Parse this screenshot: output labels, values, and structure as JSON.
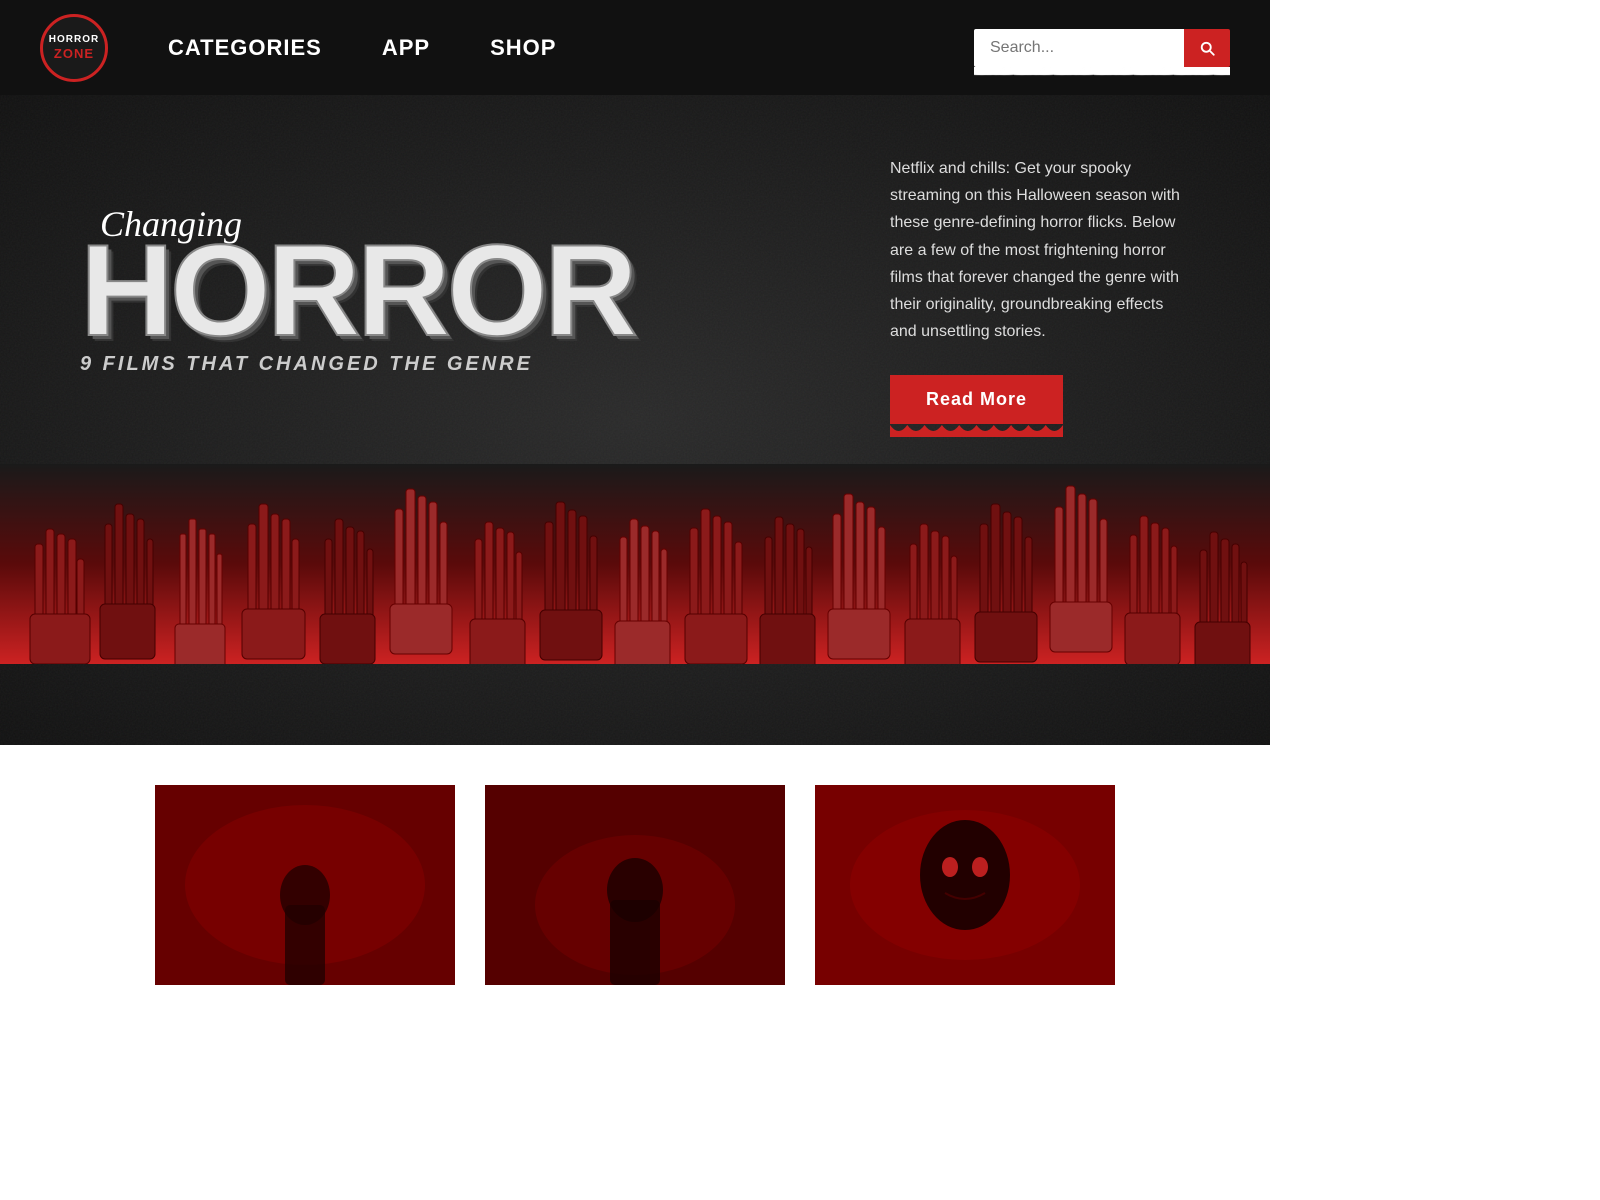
{
  "navbar": {
    "logo": {
      "top": "HORROR",
      "bottom": "ZONE",
      "aria": "Horror Zone Logo"
    },
    "links": [
      {
        "id": "categories",
        "label": "CATEGORIES"
      },
      {
        "id": "app",
        "label": "APP"
      },
      {
        "id": "shop",
        "label": "SHOP"
      }
    ],
    "search": {
      "placeholder": "Search...",
      "button_aria": "Search"
    }
  },
  "hero": {
    "changing_text": "Changing",
    "horror_text": "HORROR",
    "subtitle": "9 FILMS THAT CHANGED THE GENRE",
    "description": "Netflix and chills: Get your spooky streaming on this Halloween season with these genre-defining horror flicks. Below are a few of the most frightening horror films that forever changed the genre with their originality, groundbreaking effects and unsettling stories.",
    "read_more": "Read More"
  },
  "cards": [
    {
      "id": "card-1",
      "alt": "Horror film card 1"
    },
    {
      "id": "card-2",
      "alt": "Horror film card 2"
    },
    {
      "id": "card-3",
      "alt": "Horror film card 3"
    }
  ],
  "colors": {
    "accent_red": "#cc2222",
    "dark_red": "#8b0000",
    "bg_dark": "#1a1a1a",
    "bg_navbar": "#111111"
  }
}
